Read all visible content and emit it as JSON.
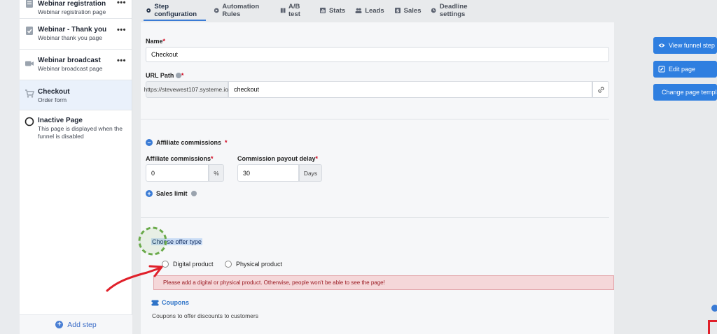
{
  "sidebar": {
    "steps": [
      {
        "title": "Webinar registration",
        "subtitle": "Webinar registration page",
        "icon": "webinar-page-icon",
        "menu": "•••"
      },
      {
        "title": "Webinar - Thank you",
        "subtitle": "Webinar thank you page",
        "icon": "thank-you-page-icon",
        "menu": "•••"
      },
      {
        "title": "Webinar broadcast",
        "subtitle": "Webinar broadcast page",
        "icon": "video-camera-icon",
        "menu": "•••"
      },
      {
        "title": "Checkout",
        "subtitle": "Order form",
        "icon": "cart-icon",
        "menu": "•••"
      },
      {
        "title": "Inactive Page",
        "subtitle": "This page is displayed when the funnel is disabled",
        "icon": "inactive-circle-icon"
      }
    ],
    "add_step": "Add step"
  },
  "tabs": [
    {
      "label": "Step configuration",
      "icon": "gear-icon"
    },
    {
      "label": "Automation Rules",
      "icon": "automation-icon"
    },
    {
      "label": "A/B test",
      "icon": "ab-test-icon"
    },
    {
      "label": "Stats",
      "icon": "stats-icon"
    },
    {
      "label": "Leads",
      "icon": "leads-icon"
    },
    {
      "label": "Sales",
      "icon": "sales-icon"
    },
    {
      "label": "Deadline settings",
      "icon": "clock-icon"
    }
  ],
  "form": {
    "name_label": "Name",
    "name_value": "Checkout",
    "url_label": "URL Path",
    "url_prefix": "https://stevewest107.systeme.io/",
    "url_value": "checkout",
    "affiliate_toggle": "Affiliate commissions",
    "affiliate_label": "Affiliate commissions",
    "affiliate_value": "0",
    "affiliate_unit": "%",
    "payout_label": "Commission payout delay",
    "payout_value": "30",
    "payout_unit": "Days",
    "sales_limit": "Sales limit",
    "offer_type_label": "Choose offer type",
    "offer_digital": "Digital product",
    "offer_physical": "Physical product",
    "alert_text": "Please add a digital or physical product. Otherwise, people won't be able to see the page!",
    "coupons_label": "Coupons",
    "coupons_desc": "Coupons to offer discounts to customers"
  },
  "actions": {
    "view_funnel_step": "View funnel step",
    "edit_page": "Edit page",
    "change_template": "Change page template"
  },
  "colors": {
    "accent": "#2f7fe0",
    "alert_bg": "#f5d7d9",
    "annotation_red": "#e0202a",
    "annotation_green": "#6aaa4a"
  }
}
